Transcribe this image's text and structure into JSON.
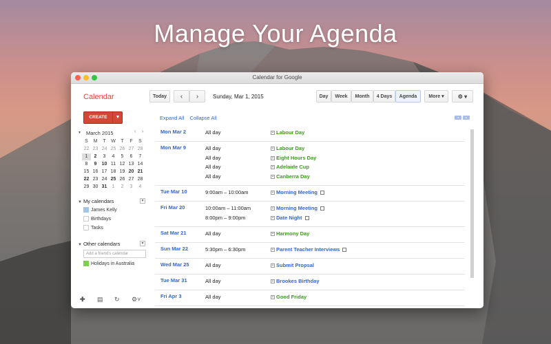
{
  "hero": {
    "title": "Manage Your Agenda"
  },
  "window": {
    "title": "Calendar for Google"
  },
  "header": {
    "brand": "Calendar",
    "today": "Today",
    "prev": "‹",
    "next": "›",
    "date": "Sunday, Mar 1, 2015",
    "views": {
      "day": "Day",
      "week": "Week",
      "month": "Month",
      "four_days": "4 Days",
      "agenda": "Agenda",
      "more": "More ▾"
    },
    "selected_view": "Agenda",
    "settings": "⚙ ▾"
  },
  "sidebar": {
    "create": "CREATE",
    "create_dd": "▼",
    "mini": {
      "title": "March 2015",
      "prev": "‹",
      "next": "›",
      "dow": [
        "S",
        "M",
        "T",
        "W",
        "T",
        "F",
        "S"
      ],
      "weeks": [
        [
          "22",
          "23",
          "24",
          "25",
          "26",
          "27",
          "28"
        ],
        [
          "1",
          "2",
          "3",
          "4",
          "5",
          "6",
          "7"
        ],
        [
          "8",
          "9",
          "10",
          "11",
          "12",
          "13",
          "14"
        ],
        [
          "15",
          "16",
          "17",
          "18",
          "19",
          "20",
          "21"
        ],
        [
          "22",
          "23",
          "24",
          "25",
          "26",
          "27",
          "28"
        ],
        [
          "29",
          "30",
          "31",
          "1",
          "2",
          "3",
          "4"
        ]
      ]
    },
    "my_calendars": {
      "label": "My calendars",
      "items": [
        "James Kelly",
        "Birthdays",
        "Tasks"
      ]
    },
    "other_calendars": {
      "label": "Other calendars",
      "placeholder": "Add a friend's calendar",
      "items": [
        "Holidays in Australia"
      ]
    },
    "colors": {
      "james": "#9fc6e7",
      "holidays": "#7bd148"
    }
  },
  "main": {
    "expand_all": "Expand All",
    "collapse_all": "Collapse All"
  },
  "agenda": [
    {
      "day": "Mon Mar 2",
      "events": [
        {
          "time": "All day",
          "title": "Labour Day",
          "color": "#3c9a1c"
        }
      ]
    },
    {
      "day": "Mon Mar 9",
      "events": [
        {
          "time": "All day",
          "title": "Labour Day",
          "color": "#3c9a1c"
        },
        {
          "time": "All day",
          "title": "Eight Hours Day",
          "color": "#3c9a1c"
        },
        {
          "time": "All day",
          "title": "Adelaide Cup",
          "color": "#3c9a1c"
        },
        {
          "time": "All day",
          "title": "Canberra Day",
          "color": "#3c9a1c"
        }
      ]
    },
    {
      "day": "Tue Mar 10",
      "events": [
        {
          "time": "9:00am – 10:00am",
          "title": "Morning Meeting",
          "color": "#3366cc",
          "reminder": true
        }
      ]
    },
    {
      "day": "Fri Mar 20",
      "events": [
        {
          "time": "10:00am – 11:00am",
          "title": "Morning Meeting",
          "color": "#3366cc",
          "reminder": true
        },
        {
          "time": "8:00pm – 9:00pm",
          "title": "Date Night",
          "color": "#3366cc",
          "reminder": true
        }
      ]
    },
    {
      "day": "Sat Mar 21",
      "events": [
        {
          "time": "All day",
          "title": "Harmony Day",
          "color": "#3c9a1c"
        }
      ]
    },
    {
      "day": "Sun Mar 22",
      "events": [
        {
          "time": "5:30pm – 6:30pm",
          "title": "Parent Teacher Interviews",
          "color": "#3366cc",
          "reminder": true
        }
      ]
    },
    {
      "day": "Wed Mar 25",
      "events": [
        {
          "time": "All day",
          "title": "Submit Propsal",
          "color": "#3366cc"
        }
      ]
    },
    {
      "day": "Tue Mar 31",
      "events": [
        {
          "time": "All day",
          "title": "Brookes Birthday",
          "color": "#3366cc"
        }
      ]
    },
    {
      "day": "Fri Apr 3",
      "events": [
        {
          "time": "All day",
          "title": "Good Friday",
          "color": "#3c9a1c"
        }
      ]
    }
  ]
}
